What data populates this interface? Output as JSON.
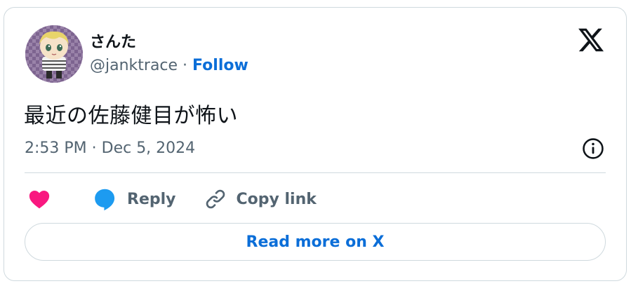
{
  "author": {
    "display_name": "さんた",
    "handle": "@janktrace",
    "separator": " · ",
    "follow_label": "Follow"
  },
  "tweet": {
    "text": "最近の佐藤健目が怖い",
    "timestamp": "2:53 PM · Dec 5, 2024"
  },
  "actions": {
    "reply_label": "Reply",
    "copy_link_label": "Copy link"
  },
  "read_more_label": "Read more on X",
  "icons": {
    "brand": "x-logo-icon",
    "info": "info-icon",
    "like": "heart-icon",
    "reply": "speech-bubble-icon",
    "copy": "link-icon"
  },
  "colors": {
    "like": "#f91880",
    "reply": "#1d9bf0",
    "link": "#0b6ed8",
    "muted": "#536471",
    "text": "#0f1419",
    "border": "#cfd9de"
  }
}
